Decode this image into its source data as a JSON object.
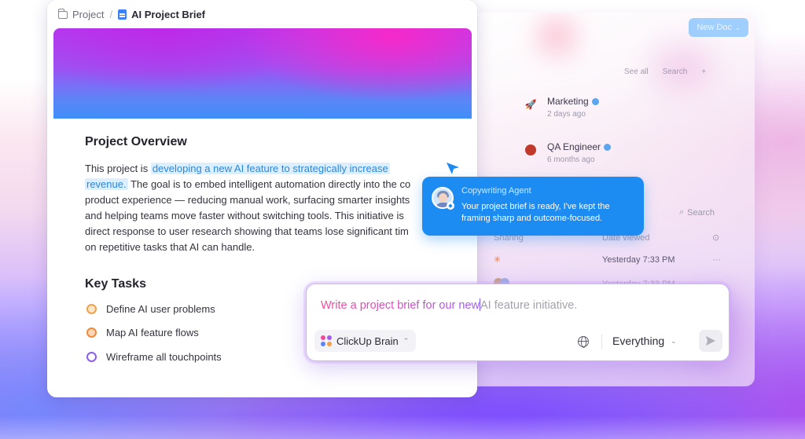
{
  "breadcrumb": {
    "parent": "Project",
    "separator": "/",
    "current": "AI Project Brief"
  },
  "document": {
    "overview_title": "Project Overview",
    "overview_lines": {
      "l1_pre": "This project is ",
      "l1_highlight": "developing a new AI feature to strategically increase",
      "l2_highlight": "revenue.",
      "l2_rest": " The goal is to embed intelligent automation directly into the co",
      "l3": "product experience — reducing manual work, surfacing smarter insights",
      "l4": "and helping teams move faster without switching tools. This initiative is",
      "l5": "direct response to user research showing that teams lose significant tim",
      "l6": "on repetitive tasks that AI can handle."
    },
    "tasks_title": "Key Tasks",
    "tasks": [
      {
        "label": "Define AI user problems",
        "color": "#f0a24a"
      },
      {
        "label": "Map AI feature flows",
        "color": "#f08a3a"
      },
      {
        "label": "Wireframe all touchpoints",
        "color": "#8b5cf6"
      }
    ]
  },
  "agent": {
    "name": "Copywriting Agent",
    "message": "Your project brief is ready, I've kept the framing sharp and outcome-focused."
  },
  "prompt": {
    "typed": "Write a project brief for our new",
    "ghost": "AI feature initiative.",
    "assistant_label": "ClickUp Brain",
    "scope_label": "Everything"
  },
  "background_app": {
    "new_doc_label": "New Doc",
    "toolbar": [
      "See all",
      "Search"
    ],
    "items": [
      {
        "name": "Marketing",
        "sub": "2 days ago"
      },
      {
        "name": "QA Engineer",
        "sub": "6 months ago"
      }
    ],
    "search_label": "Search",
    "table_header": [
      "Sharing",
      "Date viewed"
    ],
    "rows": [
      {
        "date": "Yesterday 7:33 PM"
      },
      {
        "date": "Yesterday 7:33 PM"
      }
    ]
  },
  "colors": {
    "accent_blue": "#1d8cf2",
    "highlight_bg": "#dcefff",
    "highlight_text": "#2b86df",
    "prompt_gradient_start": "#f04a9a",
    "prompt_gradient_end": "#a25bf0"
  }
}
